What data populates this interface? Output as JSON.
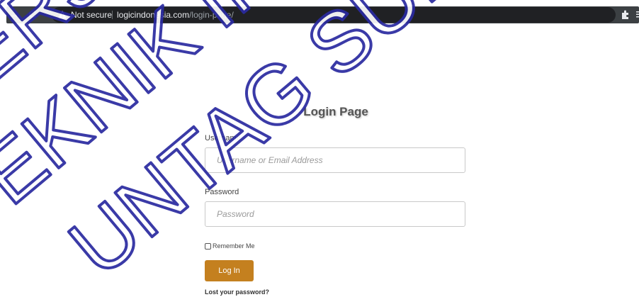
{
  "browser": {
    "security_label": "Not secure",
    "url_domain": "logicindonesia.com",
    "url_path": "/login-page/",
    "icons": [
      "back-icon",
      "reload-icon",
      "warning-icon",
      "star-icon",
      "extensions-icon",
      "menu-icon"
    ]
  },
  "watermark": {
    "lines": [
      "KERJA PRAKTEK",
      "TEKNIK INFORMATIKA",
      "UNTAG SURABAYA"
    ],
    "color": "#2a2aa0"
  },
  "login": {
    "title": "Login Page",
    "username_label": "Username",
    "username_placeholder": "Username or Email Address",
    "password_label": "Password",
    "password_placeholder": "Password",
    "remember_label": "Remember Me",
    "remember_checked": false,
    "submit_label": "Log In",
    "lost_password_label": "Lost your password?",
    "button_color": "#c4801f"
  }
}
